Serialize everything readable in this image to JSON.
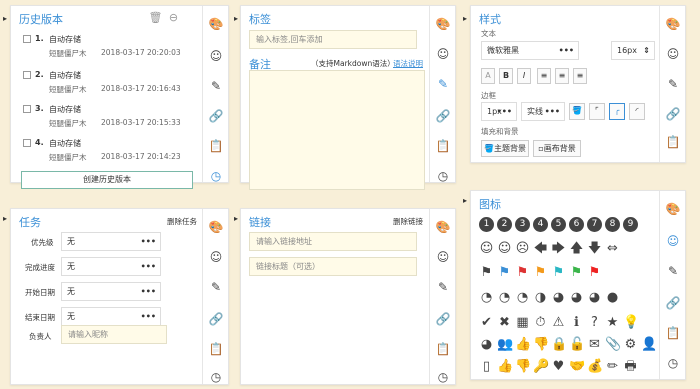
{
  "history": {
    "title": "历史版本",
    "create_button": "创建历史版本",
    "entries": [
      {
        "index": "1.",
        "name": "自动存储",
        "author": "短腿僵尸木",
        "time": "2018-03-17 20:20:03"
      },
      {
        "index": "2.",
        "name": "自动存储",
        "author": "短腿僵尸木",
        "time": "2018-03-17 20:16:43"
      },
      {
        "index": "3.",
        "name": "自动存储",
        "author": "短腿僵尸木",
        "time": "2018-03-17 20:15:33"
      },
      {
        "index": "4.",
        "name": "自动存储",
        "author": "短腿僵尸木",
        "time": "2018-03-17 20:14:23"
      }
    ]
  },
  "tags": {
    "title": "标签",
    "placeholder": "输入标签,回车添加",
    "note_title": "备注",
    "markdown_hint": "（支持Markdown语法）",
    "syntax_link": "语法说明"
  },
  "style": {
    "title": "样式",
    "text_label": "文本",
    "font_value": "微软雅黑",
    "size_value": "16px",
    "border_label": "边框",
    "border_width": "1px",
    "border_style": "实线",
    "fill_label": "填充和背景",
    "theme_bg_button": "主题背景",
    "canvas_bg_button": "画布背景",
    "format_buttons": [
      "A",
      "B",
      "I"
    ]
  },
  "task": {
    "title": "任务",
    "delete_link": "删除任务",
    "fields": [
      {
        "label": "优先级",
        "value": "无"
      },
      {
        "label": "完成进度",
        "value": "无"
      },
      {
        "label": "开始日期",
        "value": "无"
      },
      {
        "label": "结束日期",
        "value": "无"
      }
    ],
    "assignee_label": "负责人",
    "assignee_placeholder": "请输入昵称"
  },
  "link": {
    "title": "链接",
    "delete_link": "删除链接",
    "url_placeholder": "请输入链接地址",
    "title_placeholder": "链接标题（可选）"
  },
  "icons": {
    "title": "图标",
    "numbers": [
      "1",
      "2",
      "3",
      "4",
      "5",
      "6",
      "7",
      "8",
      "9"
    ]
  }
}
